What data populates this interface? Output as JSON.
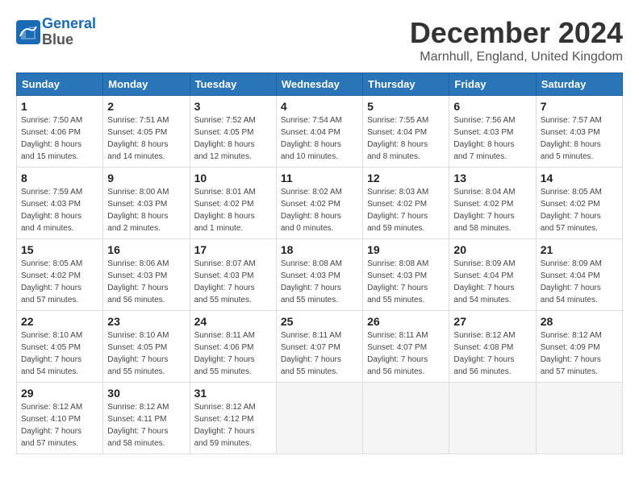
{
  "header": {
    "logo_line1": "General",
    "logo_line2": "Blue",
    "title": "December 2024",
    "subtitle": "Marnhull, England, United Kingdom"
  },
  "columns": [
    "Sunday",
    "Monday",
    "Tuesday",
    "Wednesday",
    "Thursday",
    "Friday",
    "Saturday"
  ],
  "weeks": [
    [
      {
        "day": "1",
        "info": "Sunrise: 7:50 AM\nSunset: 4:06 PM\nDaylight: 8 hours\nand 15 minutes."
      },
      {
        "day": "2",
        "info": "Sunrise: 7:51 AM\nSunset: 4:05 PM\nDaylight: 8 hours\nand 14 minutes."
      },
      {
        "day": "3",
        "info": "Sunrise: 7:52 AM\nSunset: 4:05 PM\nDaylight: 8 hours\nand 12 minutes."
      },
      {
        "day": "4",
        "info": "Sunrise: 7:54 AM\nSunset: 4:04 PM\nDaylight: 8 hours\nand 10 minutes."
      },
      {
        "day": "5",
        "info": "Sunrise: 7:55 AM\nSunset: 4:04 PM\nDaylight: 8 hours\nand 8 minutes."
      },
      {
        "day": "6",
        "info": "Sunrise: 7:56 AM\nSunset: 4:03 PM\nDaylight: 8 hours\nand 7 minutes."
      },
      {
        "day": "7",
        "info": "Sunrise: 7:57 AM\nSunset: 4:03 PM\nDaylight: 8 hours\nand 5 minutes."
      }
    ],
    [
      {
        "day": "8",
        "info": "Sunrise: 7:59 AM\nSunset: 4:03 PM\nDaylight: 8 hours\nand 4 minutes."
      },
      {
        "day": "9",
        "info": "Sunrise: 8:00 AM\nSunset: 4:03 PM\nDaylight: 8 hours\nand 2 minutes."
      },
      {
        "day": "10",
        "info": "Sunrise: 8:01 AM\nSunset: 4:02 PM\nDaylight: 8 hours\nand 1 minute."
      },
      {
        "day": "11",
        "info": "Sunrise: 8:02 AM\nSunset: 4:02 PM\nDaylight: 8 hours\nand 0 minutes."
      },
      {
        "day": "12",
        "info": "Sunrise: 8:03 AM\nSunset: 4:02 PM\nDaylight: 7 hours\nand 59 minutes."
      },
      {
        "day": "13",
        "info": "Sunrise: 8:04 AM\nSunset: 4:02 PM\nDaylight: 7 hours\nand 58 minutes."
      },
      {
        "day": "14",
        "info": "Sunrise: 8:05 AM\nSunset: 4:02 PM\nDaylight: 7 hours\nand 57 minutes."
      }
    ],
    [
      {
        "day": "15",
        "info": "Sunrise: 8:05 AM\nSunset: 4:02 PM\nDaylight: 7 hours\nand 57 minutes."
      },
      {
        "day": "16",
        "info": "Sunrise: 8:06 AM\nSunset: 4:03 PM\nDaylight: 7 hours\nand 56 minutes."
      },
      {
        "day": "17",
        "info": "Sunrise: 8:07 AM\nSunset: 4:03 PM\nDaylight: 7 hours\nand 55 minutes."
      },
      {
        "day": "18",
        "info": "Sunrise: 8:08 AM\nSunset: 4:03 PM\nDaylight: 7 hours\nand 55 minutes."
      },
      {
        "day": "19",
        "info": "Sunrise: 8:08 AM\nSunset: 4:03 PM\nDaylight: 7 hours\nand 55 minutes."
      },
      {
        "day": "20",
        "info": "Sunrise: 8:09 AM\nSunset: 4:04 PM\nDaylight: 7 hours\nand 54 minutes."
      },
      {
        "day": "21",
        "info": "Sunrise: 8:09 AM\nSunset: 4:04 PM\nDaylight: 7 hours\nand 54 minutes."
      }
    ],
    [
      {
        "day": "22",
        "info": "Sunrise: 8:10 AM\nSunset: 4:05 PM\nDaylight: 7 hours\nand 54 minutes."
      },
      {
        "day": "23",
        "info": "Sunrise: 8:10 AM\nSunset: 4:05 PM\nDaylight: 7 hours\nand 55 minutes."
      },
      {
        "day": "24",
        "info": "Sunrise: 8:11 AM\nSunset: 4:06 PM\nDaylight: 7 hours\nand 55 minutes."
      },
      {
        "day": "25",
        "info": "Sunrise: 8:11 AM\nSunset: 4:07 PM\nDaylight: 7 hours\nand 55 minutes."
      },
      {
        "day": "26",
        "info": "Sunrise: 8:11 AM\nSunset: 4:07 PM\nDaylight: 7 hours\nand 56 minutes."
      },
      {
        "day": "27",
        "info": "Sunrise: 8:12 AM\nSunset: 4:08 PM\nDaylight: 7 hours\nand 56 minutes."
      },
      {
        "day": "28",
        "info": "Sunrise: 8:12 AM\nSunset: 4:09 PM\nDaylight: 7 hours\nand 57 minutes."
      }
    ],
    [
      {
        "day": "29",
        "info": "Sunrise: 8:12 AM\nSunset: 4:10 PM\nDaylight: 7 hours\nand 57 minutes."
      },
      {
        "day": "30",
        "info": "Sunrise: 8:12 AM\nSunset: 4:11 PM\nDaylight: 7 hours\nand 58 minutes."
      },
      {
        "day": "31",
        "info": "Sunrise: 8:12 AM\nSunset: 4:12 PM\nDaylight: 7 hours\nand 59 minutes."
      },
      null,
      null,
      null,
      null
    ]
  ]
}
